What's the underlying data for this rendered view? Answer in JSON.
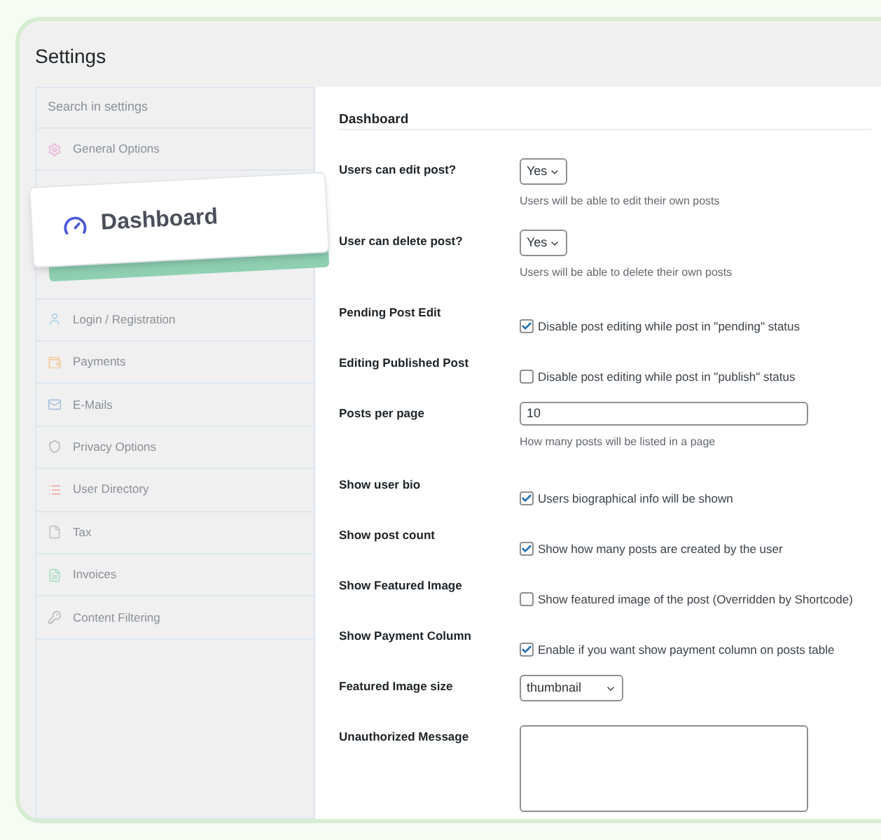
{
  "title": "Settings",
  "sidebar": {
    "search": {
      "placeholder": "Search in settings"
    },
    "items": [
      {
        "label": "General Options"
      },
      {
        "label": "Login / Registration"
      },
      {
        "label": "Payments"
      },
      {
        "label": "E-Mails"
      },
      {
        "label": "Privacy Options"
      },
      {
        "label": "User Directory"
      },
      {
        "label": "Tax"
      },
      {
        "label": "Invoices"
      },
      {
        "label": "Content Filtering"
      }
    ]
  },
  "floating_card": {
    "label": "Dashboard"
  },
  "section": {
    "title": "Dashboard",
    "rows": [
      {
        "kind": "select",
        "label": "Users can edit post?",
        "value": "Yes",
        "help": "Users will be able to edit their own posts"
      },
      {
        "kind": "select",
        "label": "User can delete post?",
        "value": "Yes",
        "help": "Users will be able to delete their own posts"
      },
      {
        "kind": "checkbox",
        "label": "Pending Post Edit",
        "checked": true,
        "text": "Disable post editing while post in \"pending\" status"
      },
      {
        "kind": "checkbox",
        "label": "Editing Published Post",
        "checked": false,
        "text": "Disable post editing while post in \"publish\" status"
      },
      {
        "kind": "text",
        "label": "Posts per page",
        "value": "10",
        "help": "How many posts will be listed in a page"
      },
      {
        "kind": "checkbox",
        "label": "Show user bio",
        "checked": true,
        "text": "Users biographical info will be shown"
      },
      {
        "kind": "checkbox",
        "label": "Show post count",
        "checked": true,
        "text": "Show how many posts are created by the user"
      },
      {
        "kind": "checkbox",
        "label": "Show Featured Image",
        "checked": false,
        "text": "Show featured image of the post (Overridden by Shortcode)"
      },
      {
        "kind": "checkbox",
        "label": "Show Payment Column",
        "checked": true,
        "text": "Enable if you want show payment column on posts table"
      },
      {
        "kind": "wideselect",
        "label": "Featured Image size",
        "value": "thumbnail"
      },
      {
        "kind": "textarea",
        "label": "Unauthorized Message"
      }
    ]
  }
}
